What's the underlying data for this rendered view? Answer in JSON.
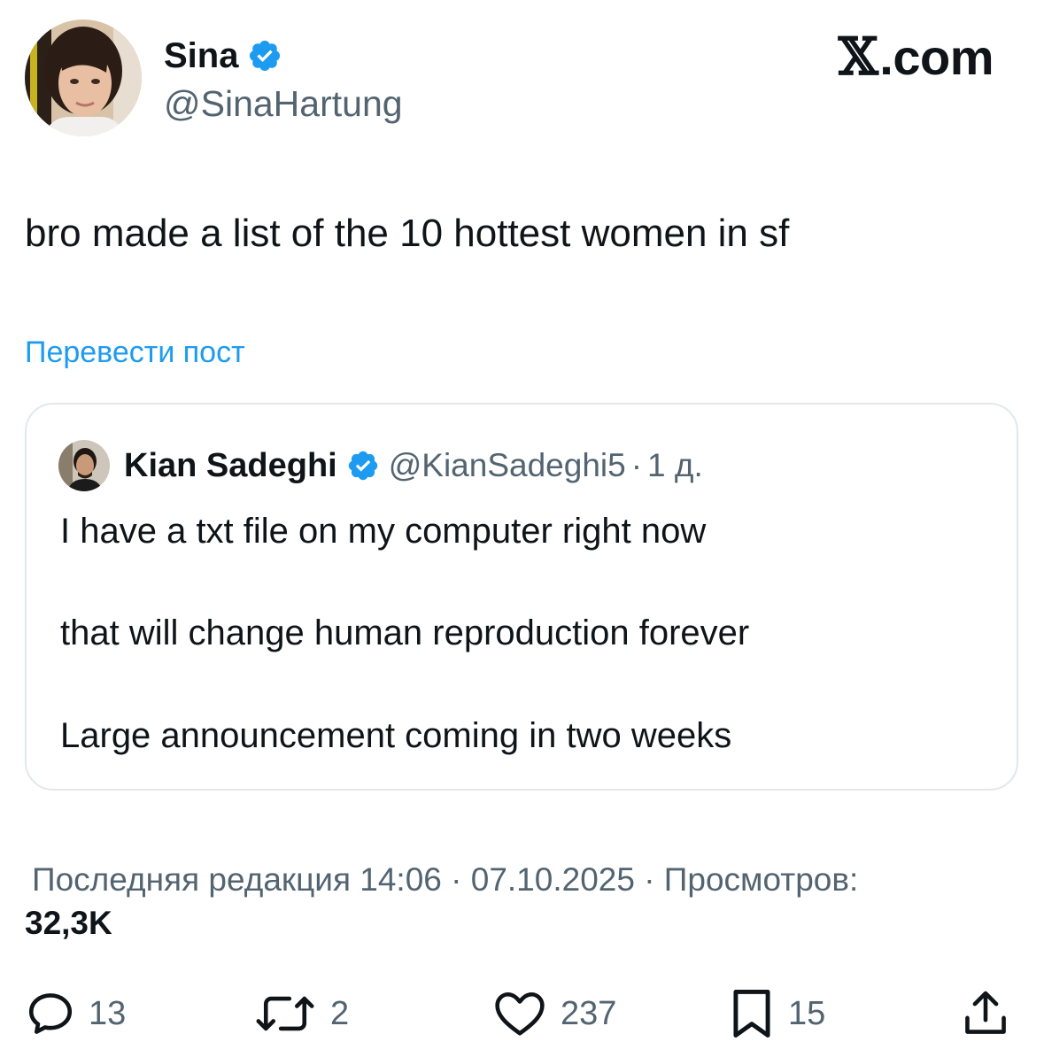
{
  "post": {
    "author_name": "Sina",
    "author_handle": "@SinaHartung",
    "site_label": ".com",
    "text": "bro made a list of the 10 hottest women in sf",
    "translate_label": "Перевести пост"
  },
  "quote": {
    "author_name": "Kian Sadeghi",
    "author_handle": "@KianSadeghi5",
    "separator": "·",
    "time": "1 д.",
    "lines": [
      "I have a txt file on my computer right now",
      "that will change human reproduction forever",
      "Large announcement coming in two weeks"
    ]
  },
  "meta": {
    "edited_line": "Последняя редакция 14:06 · 07.10.2025  · Просмотров:",
    "views": "32,3K"
  },
  "actions": {
    "replies": "13",
    "reposts": "2",
    "likes": "237",
    "bookmarks": "15"
  },
  "colors": {
    "text_primary": "#0f1419",
    "text_secondary": "#536471",
    "link_blue": "#1d9bf0",
    "verified_blue": "#1d9bf0",
    "card_border": "#e1e8ed"
  },
  "icons": {
    "verified": "verified-badge-icon",
    "reply": "speech-bubble-icon",
    "repost": "repost-arrows-icon",
    "like": "heart-icon",
    "bookmark": "bookmark-icon",
    "share": "share-upload-icon"
  }
}
